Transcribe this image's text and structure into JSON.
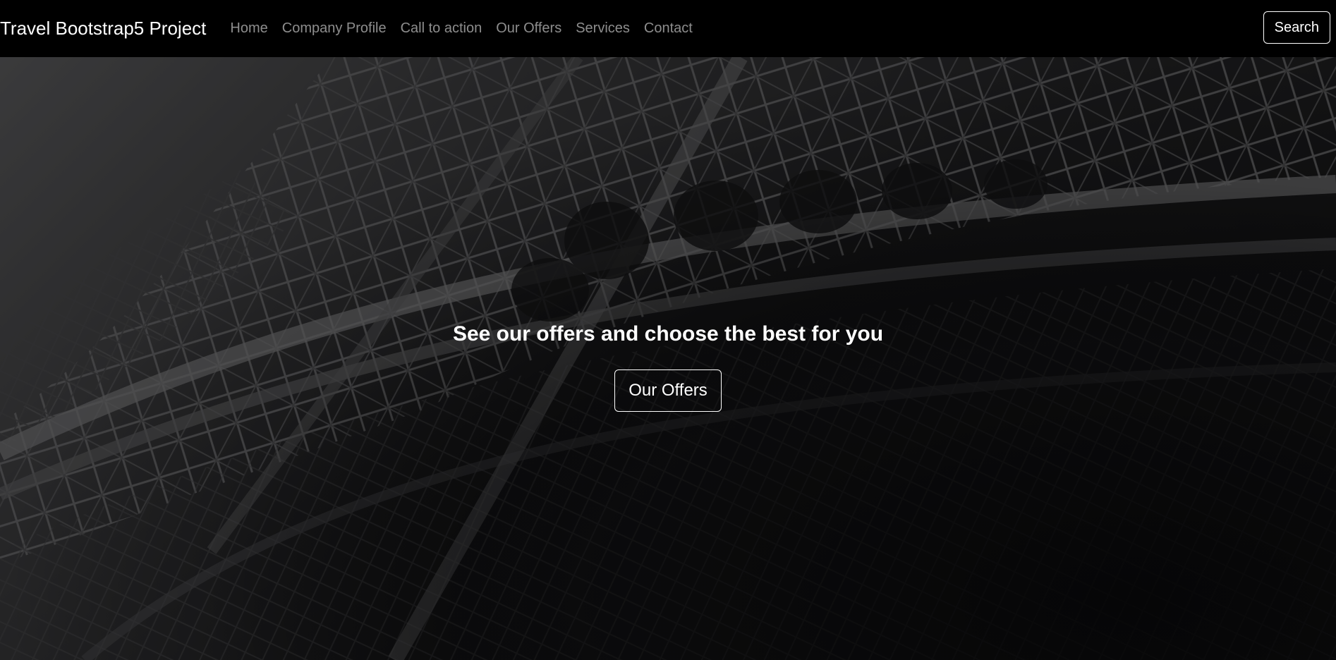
{
  "navbar": {
    "brand": "Travel Bootstrap5 Project",
    "links": [
      {
        "label": "Home"
      },
      {
        "label": "Company Profile"
      },
      {
        "label": "Call to action"
      },
      {
        "label": "Our Offers"
      },
      {
        "label": "Services"
      },
      {
        "label": "Contact"
      }
    ],
    "search_label": "Search"
  },
  "hero": {
    "background_image": "eiffel-tower-lattice-image",
    "title": "See our offers and choose the best for you",
    "button_label": "Our Offers"
  },
  "colors": {
    "navbar_bg": "#000000",
    "nav_link": "#8c8c8c",
    "text": "#ffffff"
  }
}
